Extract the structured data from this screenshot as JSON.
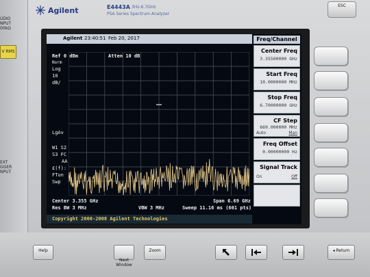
{
  "left_panel": {
    "top_text": "UDIO\nNPUT\n00kΩ",
    "rms_button": "V RMS",
    "trigger_text": "EXT\nGGER\nNPUT"
  },
  "brand": {
    "name": "Agilent",
    "model": "E4443A",
    "range": "3Hz-6.7GHz",
    "series": "PSA Series Spectrum Analyzer"
  },
  "esc_label": "ESC",
  "screen": {
    "status": {
      "vendor": "Agilent",
      "time": "23:40:51",
      "date": "Feb 20, 2017"
    },
    "ref": "Ref 0 dBm",
    "atten": "Atten 10 dB",
    "mode": "Norm",
    "scale": [
      "Log",
      "10",
      "dB/"
    ],
    "left_labels": {
      "lgav": "LgAv",
      "w1s2": "W1  S2",
      "s3fc": "S3  FC",
      "aa": "AA",
      "ff": "£(f):",
      "ftun": "FTun",
      "swp": "Swp"
    },
    "center": "Center 3.355 GHz",
    "span": "Span 6.69 GHz",
    "res_bw": "Res BW 3 MHz",
    "vbw": "VBW 3 MHz",
    "sweep": "Sweep 11.16 ms (601 pts)",
    "copyright": "Copyright 2000-2008 Agilent Technologies"
  },
  "softkeys": {
    "title": "Freq/Channel",
    "items": [
      {
        "label": "Center Freq",
        "value": "3.35500000 GHz"
      },
      {
        "label": "Start Freq",
        "value": "10.0000000 MHz"
      },
      {
        "label": "Stop Freq",
        "value": "6.70000000 GHz"
      },
      {
        "label": "CF Step",
        "value": "669.000000 MHz",
        "left": "Auto",
        "right": "Man"
      },
      {
        "label": "Freq Offset",
        "value": "0.00000000 Hz"
      },
      {
        "label": "Signal Track",
        "value": "",
        "left": "On",
        "right": "Off"
      }
    ]
  },
  "bottom_keys": {
    "help": "Help",
    "next_window": "Next\nWindow",
    "zoom": "Zoom",
    "return": "Return"
  },
  "trace_color": "#e8c98a"
}
